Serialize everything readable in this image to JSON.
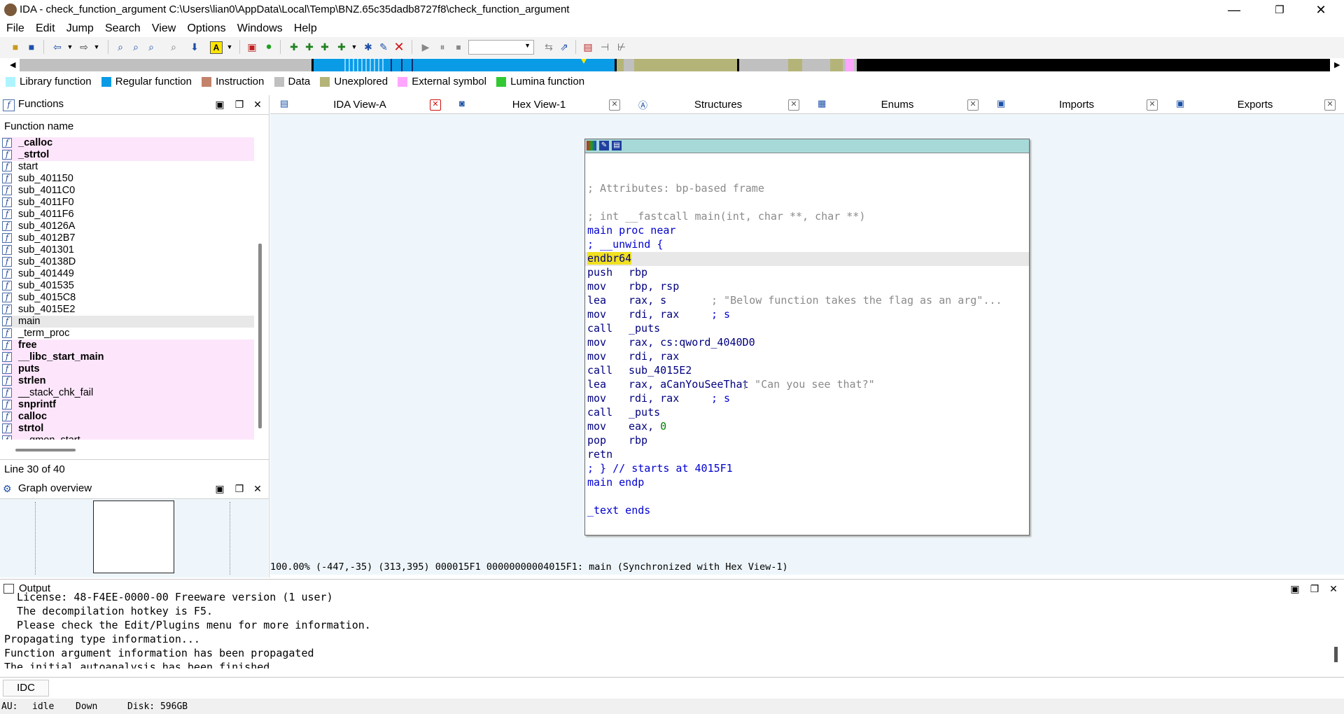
{
  "window": {
    "title": "IDA - check_function_argument C:\\Users\\lian0\\AppData\\Local\\Temp\\BNZ.65c35dadb8727f8\\check_function_argument",
    "minimize": "—",
    "maximize": "❐",
    "close": "✕"
  },
  "menu": [
    "File",
    "Edit",
    "Jump",
    "Search",
    "View",
    "Options",
    "Windows",
    "Help"
  ],
  "colors": {
    "library": "#aef4ff",
    "regular": "#0a9be6",
    "instruction": "#c3826a",
    "data": "#c0c0c0",
    "unexplored": "#b4b478",
    "external": "#ffa6ff",
    "lumina": "#32c832",
    "node_header": "#a8d9d9",
    "highlight": "#f0e020"
  },
  "legend": [
    {
      "label": "Library function",
      "color": "#aef4ff"
    },
    {
      "label": "Regular function",
      "color": "#0a9be6"
    },
    {
      "label": "Instruction",
      "color": "#c3826a"
    },
    {
      "label": "Data",
      "color": "#c0c0c0"
    },
    {
      "label": "Unexplored",
      "color": "#b4b478"
    },
    {
      "label": "External symbol",
      "color": "#ffa6ff"
    },
    {
      "label": "Lumina function",
      "color": "#32c832"
    }
  ],
  "functions_panel": {
    "title": "Functions",
    "column": "Function name",
    "status": "Line 30 of 40",
    "items": [
      {
        "name": "_calloc",
        "style": "lib-bold"
      },
      {
        "name": "_strtol",
        "style": "lib-bold"
      },
      {
        "name": "start",
        "style": "normal"
      },
      {
        "name": "sub_401150",
        "style": "normal"
      },
      {
        "name": "sub_4011C0",
        "style": "normal"
      },
      {
        "name": "sub_4011F0",
        "style": "normal"
      },
      {
        "name": "sub_4011F6",
        "style": "normal"
      },
      {
        "name": "sub_40126A",
        "style": "normal"
      },
      {
        "name": "sub_4012B7",
        "style": "normal"
      },
      {
        "name": "sub_401301",
        "style": "normal"
      },
      {
        "name": "sub_40138D",
        "style": "normal"
      },
      {
        "name": "sub_401449",
        "style": "normal"
      },
      {
        "name": "sub_401535",
        "style": "normal"
      },
      {
        "name": "sub_4015C8",
        "style": "normal"
      },
      {
        "name": "sub_4015E2",
        "style": "normal"
      },
      {
        "name": "main",
        "style": "sel"
      },
      {
        "name": "_term_proc",
        "style": "normal"
      },
      {
        "name": "free",
        "style": "lib-bold"
      },
      {
        "name": "__libc_start_main",
        "style": "lib-bold"
      },
      {
        "name": "puts",
        "style": "lib-bold"
      },
      {
        "name": "strlen",
        "style": "lib-bold"
      },
      {
        "name": "__stack_chk_fail",
        "style": "lib"
      },
      {
        "name": "snprintf",
        "style": "lib-bold"
      },
      {
        "name": "calloc",
        "style": "lib-bold"
      },
      {
        "name": "strtol",
        "style": "lib-bold"
      },
      {
        "name": "__gmon_start__",
        "style": "lib"
      }
    ]
  },
  "graph_overview": {
    "title": "Graph overview"
  },
  "tabs": [
    {
      "label": "IDA View-A",
      "icon": "ida-view-icon"
    },
    {
      "label": "Hex View-1",
      "icon": "hex-view-icon"
    },
    {
      "label": "Structures",
      "icon": "structures-icon"
    },
    {
      "label": "Enums",
      "icon": "enums-icon"
    },
    {
      "label": "Imports",
      "icon": "imports-icon"
    },
    {
      "label": "Exports",
      "icon": "exports-icon"
    }
  ],
  "disasm": {
    "attr_comment": "; Attributes: bp-based frame",
    "proto_comment": "; int __fastcall main(int, char **, char **)",
    "proc": "main proc near",
    "unwind": "; __unwind {",
    "endbr": "endbr64",
    "lines": [
      {
        "mn": "push",
        "op": "rbp",
        "cmt": ""
      },
      {
        "mn": "mov",
        "op": "rbp, rsp",
        "cmt": ""
      },
      {
        "mn": "lea",
        "op": "rax, s",
        "cmt": "; \"Below function takes the flag as an arg\"..."
      },
      {
        "mn": "mov",
        "op": "rdi, rax",
        "cmt": "; s"
      },
      {
        "mn": "call",
        "op": "_puts",
        "cmt": ""
      },
      {
        "mn": "mov",
        "op": "rax, cs:qword_4040D0",
        "cmt": ""
      },
      {
        "mn": "mov",
        "op": "rdi, rax",
        "cmt": ""
      },
      {
        "mn": "call",
        "op": "sub_4015E2",
        "cmt": ""
      },
      {
        "mn": "lea",
        "op": "rax, aCanYouSeeThat",
        "cmt": "; \"Can you see that?\""
      },
      {
        "mn": "mov",
        "op": "rdi, rax",
        "cmt": "; s"
      },
      {
        "mn": "call",
        "op": "_puts",
        "cmt": ""
      },
      {
        "mn": "mov",
        "op": "eax, 0",
        "cmt": ""
      },
      {
        "mn": "pop",
        "op": "rbp",
        "cmt": ""
      },
      {
        "mn": "retn",
        "op": "",
        "cmt": ""
      }
    ],
    "unwind_end": "; } // starts at 4015F1",
    "endp": "main endp",
    "text_ends": "_text ends"
  },
  "view_status": "100.00% (-447,-35) (313,395) 000015F1 00000000004015F1: main (Synchronized with Hex View-1)",
  "output": {
    "title": "Output",
    "lines": [
      "  License: 48-F4EE-0000-00 Freeware version (1 user)",
      "  The decompilation hotkey is F5.",
      "  Please check the Edit/Plugins menu for more information.",
      "Propagating type information...",
      "Function argument information has been propagated",
      "The initial autoanalysis has been finished."
    ]
  },
  "idc": {
    "button": "IDC",
    "value": ""
  },
  "statusbar": {
    "au_label": "AU:",
    "au_state": "idle",
    "direction": "Down",
    "disk": "Disk: 596GB"
  }
}
